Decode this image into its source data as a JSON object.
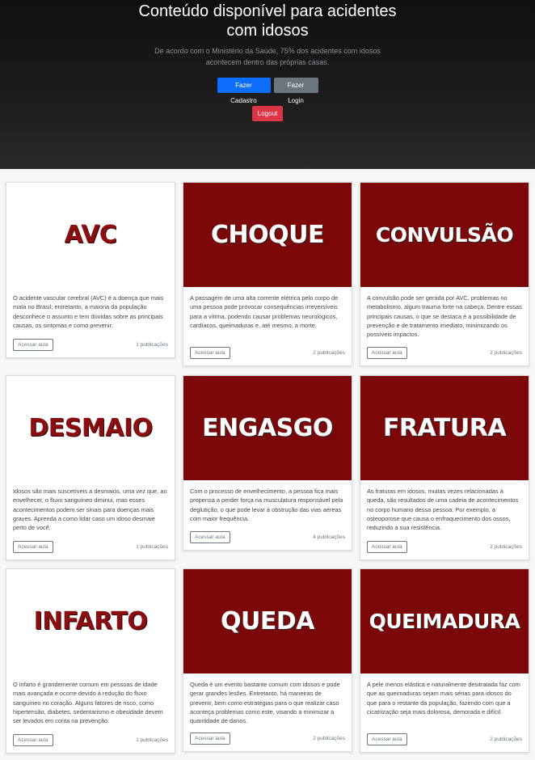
{
  "hero": {
    "title": "Conteúdo disponível para acidentes com idosos",
    "subtitle": "De acordo com o Ministério da Saúde, 75% dos acidentes com idosos acontecem dentro das próprias casas.",
    "register_label": "Fazer Cadastro",
    "login_label": "Fazer Login",
    "logout_label": "Logout"
  },
  "colors": {
    "primary": "#0d6efd",
    "secondary": "#6c757d",
    "danger": "#dc3545",
    "banner_dark": "#7b0709",
    "banner_text_light": "#8a0e10"
  },
  "cards": [
    {
      "title": "AVC",
      "style": "light",
      "description": "O acidente vascular cerebral (AVC) é a doença que mais mata no Brasil; entretanto, a maioria da população desconhece o assunto e tem dúvidas sobre as principais causas, os sintomas e como prevenir.",
      "button": "Acessar aula",
      "count": "1 publicações"
    },
    {
      "title": "CHOQUE",
      "style": "dark",
      "description": "A passagem de uma alta corrente elétrica pelo corpo de uma pessoa pode provocar consequências irreversíveis para a vítima, podendo causar problemas neurológicos, cardíacos, queimaduras e, até mesmo, a morte.",
      "button": "Acessar aula",
      "count": "2 publicações"
    },
    {
      "title": "CONVULSÃO",
      "style": "dark",
      "description": "A convulsão pode ser gerada por AVC, problemas no metabolismo, algum trauma forte na cabeça. Dentre essas principais causas, o que se destaca é a possibilidade de prevenção e de tratamento imediato, minimizando os possíveis impactos.",
      "button": "Acessar aula",
      "count": "2 publicações"
    },
    {
      "title": "DESMAIO",
      "style": "light",
      "description": "Idosos são mais suscetíveis a desmaios, uma vez que, ao envelhecer, o fluxo sanguíneo diminui, mas esses acontecimentos podem ser sinais para doenças mais graves. Aprenda a como lidar caso um idoso desmaie perto de você.",
      "button": "Acessar aula",
      "count": "1 publicações"
    },
    {
      "title": "ENGASGO",
      "style": "dark",
      "description": "Com o processo de envelhecimento, a pessoa fica mais propensa a perder força na musculatura responsável pela deglutição, o que pode levar à obstrução das vias aéreas com maior frequência.",
      "button": "Acessar aula",
      "count": "4 publicações"
    },
    {
      "title": "FRATURA",
      "style": "dark",
      "description": "As fraturas em idosos, muitas vezes relacionadas à queda, são resultados de uma cadeia de acontecimentos no corpo humano dessa pessoa. Por exemplo, a osteoporose que causa o enfraquecimento dos ossos, reduzindo a sua resistência.",
      "button": "Acessar aula",
      "count": "2 publicações"
    },
    {
      "title": "INFARTO",
      "style": "light",
      "description": "O infarto é grandemente comum em pessoas de idade mais avançada e ocorre devido à redução do fluxo sanguíneo no coração. Alguns fatores de risco, como hipertensão, diabetes, sedentarismo e obesidade devem ser levados em conta na prevenção.",
      "button": "Acessar aula",
      "count": "1 publicações"
    },
    {
      "title": "QUEDA",
      "style": "dark",
      "description": "Queda é um evento bastante comum com idosos e pode gerar grandes lesões. Entretanto, há maneiras de prevenir, bem como estratégias para o que realizar caso aconteça problemas como este, visando a minimizar a quantidade de danos.",
      "button": "Acessar aula",
      "count": "2 publicações"
    },
    {
      "title": "QUEIMADURA",
      "style": "dark",
      "description": "A pele menos elástica e naturalmente desitratada faz com que as queimaduras sejam mais sérias para idosos do que para o restante da população, fazendo com que a cicatrização seja mais dolorosa, demorada e difícil.",
      "button": "Acessar aula",
      "count": "2 publicações"
    }
  ]
}
